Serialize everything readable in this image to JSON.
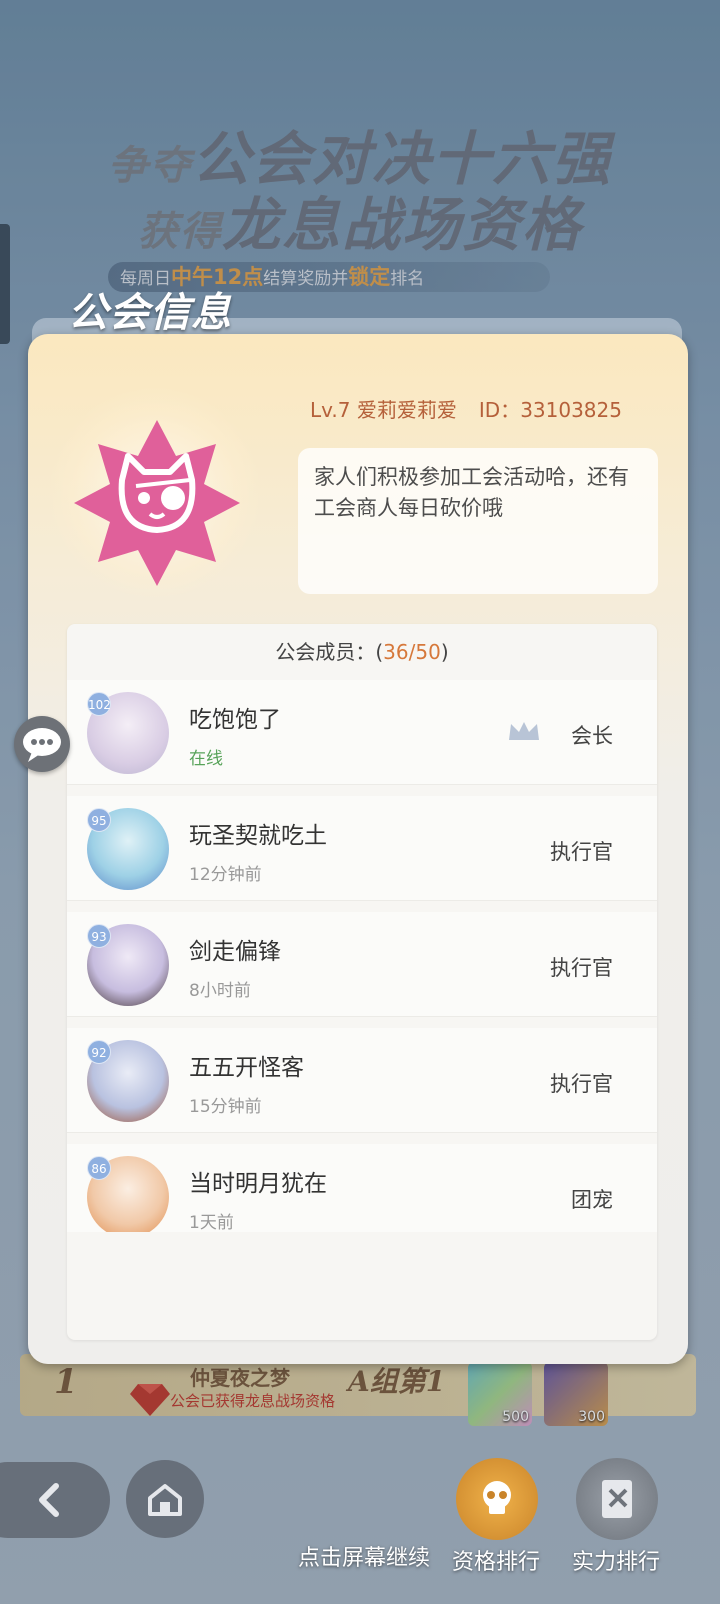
{
  "banner": {
    "line1_small": "争夺",
    "line1_big": "公会对决十六强",
    "line2_small": "获得",
    "line2_big": "龙息战场资格",
    "note_prefix": "每周日",
    "note_hl1": "中午12点",
    "note_mid": "结算奖励并",
    "note_hl2": "锁定",
    "note_suffix": "排名"
  },
  "panel": {
    "title": "公会信息",
    "guild": {
      "level": "Lv.7",
      "name": "爱莉爱莉爱",
      "id_label": "ID：",
      "id": "33103825",
      "motto": "家人们积极参加工会活动哈，还有工会商人每日砍价哦",
      "badge_color": "#e0609a"
    },
    "members_label": "公会成员：(",
    "members_count": "36/50",
    "members_close": ")",
    "members": [
      {
        "level": "102",
        "name": "吃饱饱了",
        "status": "在线",
        "role": "会长"
      },
      {
        "level": "95",
        "name": "玩圣契就吃土",
        "status": "12分钟前",
        "role": "执行官"
      },
      {
        "level": "93",
        "name": "剑走偏锋",
        "status": "8小时前",
        "role": "执行官"
      },
      {
        "level": "92",
        "name": "五五开怪客",
        "status": "15分钟前",
        "role": "执行官"
      },
      {
        "level": "86",
        "name": "当时明月犹在",
        "status": "1天前",
        "role": "团宠"
      }
    ]
  },
  "ranking": {
    "rank": "1",
    "guild_name": "仲夏夜之梦",
    "sub": "公会已获得龙息战场资格",
    "group": "A组第1",
    "reward1_qty": "500",
    "reward2_qty": "300"
  },
  "footer": {
    "continue": "点击屏幕继续",
    "btn_qualify": "资格排行",
    "btn_power": "实力排行"
  },
  "colors": {
    "accent_orange": "#d6783a",
    "online_green": "#58a35a",
    "guild_name_color": "#b5603a"
  },
  "icons": [
    "chat-bubble-icon",
    "crown-icon",
    "back-arrow-icon",
    "home-icon",
    "skull-icon",
    "book-icon",
    "gem-icon",
    "cat-badge-icon"
  ]
}
